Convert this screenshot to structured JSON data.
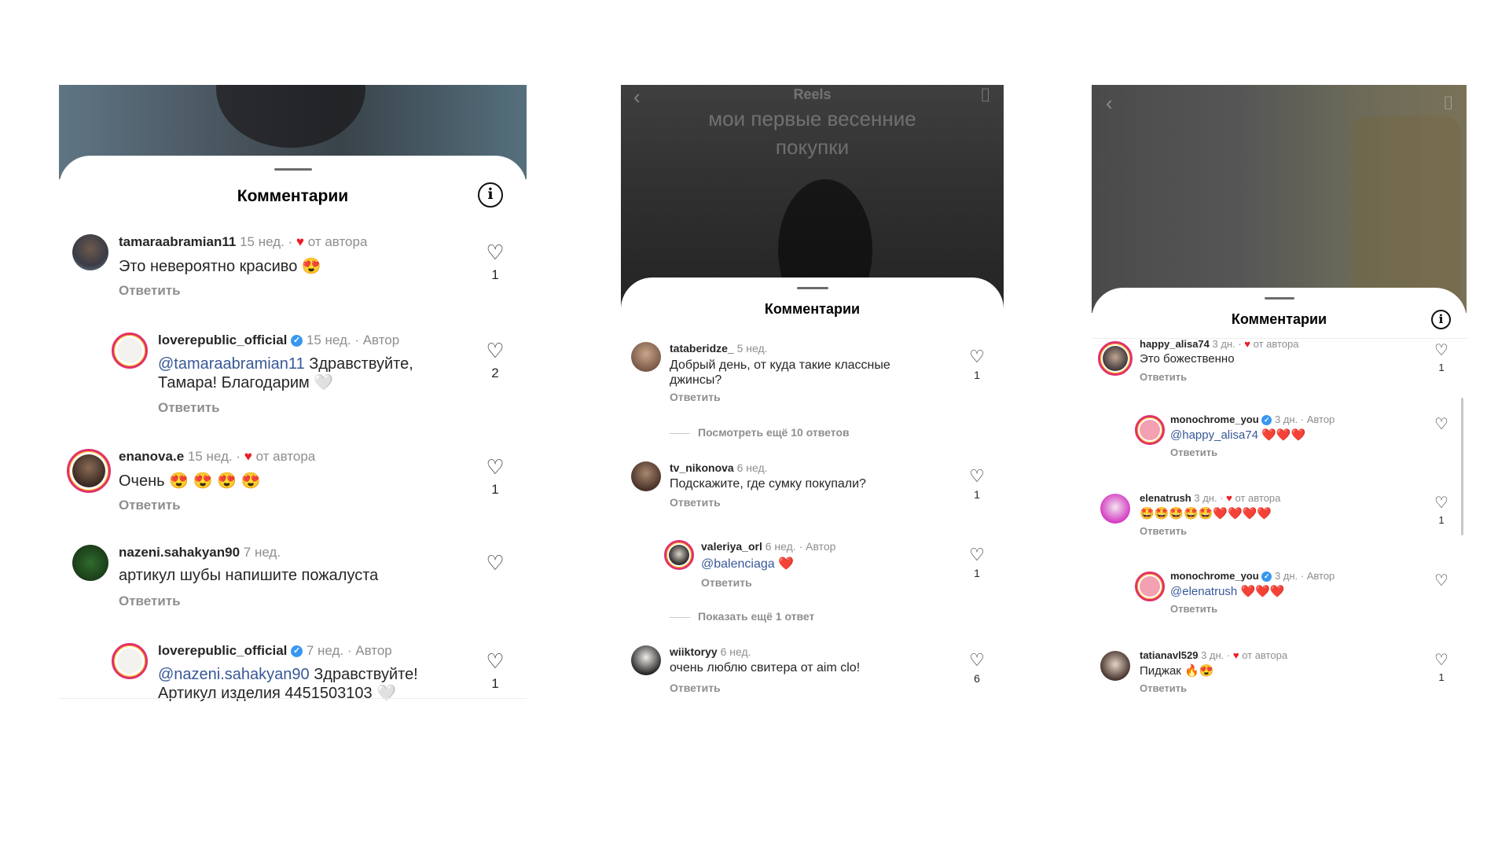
{
  "panel1": {
    "sheet_title": "Комментарии",
    "comments": [
      {
        "user": "tamaraabramian11",
        "time": "15 нед.",
        "from_author": "от автора",
        "text": "Это невероятно красиво 😍",
        "reply": "Ответить",
        "likes": "1"
      },
      {
        "user": "loverepublic_official",
        "time": "15 нед.",
        "author": "Автор",
        "mention": "@tamaraabramian11",
        "text": " Здравствуйте,",
        "text2": "Тамара! Благодарим 🤍",
        "reply": "Ответить",
        "likes": "2"
      },
      {
        "user": "enanova.e",
        "time": "15 нед.",
        "from_author": "от автора",
        "text": "Очень 😍 😍 😍 😍",
        "reply": "Ответить",
        "likes": "1"
      },
      {
        "user": "nazeni.sahakyan90",
        "time": "7 нед.",
        "text": "артикул шубы напишите пожалуста",
        "reply": "Ответить",
        "likes": ""
      },
      {
        "user": "loverepublic_official",
        "time": "7 нед.",
        "author": "Автор",
        "mention": "@nazeni.sahakyan90",
        "text": " Здравствуйте!",
        "text2": "Артикул изделия 4451503103 🤍",
        "likes": "1"
      }
    ]
  },
  "panel2": {
    "header_title": "Reels",
    "overlay_line1": "мои первые весенние",
    "overlay_line2": "покупки",
    "sheet_title": "Комментарии",
    "comments": [
      {
        "user": "tataberidze_",
        "time": "5 нед.",
        "text": "Добрый день, от куда такие классные",
        "text2": "джинсы?",
        "reply": "Ответить",
        "likes": "1"
      },
      {
        "user": "tv_nikonova",
        "time": "6 нед.",
        "text": "Подскажите, где сумку покупали?",
        "reply": "Ответить",
        "likes": "1"
      },
      {
        "user": "valeriya_orl",
        "time": "6 нед.",
        "author": "Автор",
        "mention": "@balenciaga",
        "text": " ❤️",
        "reply": "Ответить",
        "likes": "1"
      },
      {
        "user": "wiiktoryy",
        "time": "6 нед.",
        "text": "очень люблю свитера от aim clo!",
        "reply": "Ответить",
        "likes": "6"
      }
    ],
    "view_more_1": "Посмотреть ещё 10 ответов",
    "view_more_2": "Показать ещё 1 ответ"
  },
  "panel3": {
    "sheet_title": "Комментарии",
    "comments": [
      {
        "user": "happy_alisa74",
        "time": "3 дн.",
        "from_author": "от автора",
        "text": "Это божественно",
        "reply": "Ответить",
        "likes": "1"
      },
      {
        "user": "monochrome_you",
        "time": "3 дн.",
        "author": "Автор",
        "mention": "@happy_alisa74",
        "text": " ❤️❤️❤️",
        "reply": "Ответить",
        "likes": ""
      },
      {
        "user": "elenatrush",
        "time": "3 дн.",
        "from_author": "от автора",
        "text": "🤩🤩🤩🤩🤩❤️❤️❤️❤️",
        "reply": "Ответить",
        "likes": "1"
      },
      {
        "user": "monochrome_you",
        "time": "3 дн.",
        "author": "Автор",
        "mention": "@elenatrush",
        "text": " ❤️❤️❤️",
        "reply": "Ответить",
        "likes": ""
      },
      {
        "user": "tatianavl529",
        "time": "3 дн.",
        "from_author": "от автора",
        "text": "Пиджак 🔥😍",
        "reply": "Ответить",
        "likes": "1"
      }
    ]
  },
  "icons": {
    "like": "heart-outline-icon",
    "info": "info-icon",
    "back": "chevron-left-icon",
    "camera": "camera-icon",
    "verified": "verified-badge-icon"
  },
  "colors": {
    "mention": "#385898",
    "from_author_heart": "#ed1c24",
    "verified": "#3897f0",
    "muted": "#8e8e8e"
  }
}
